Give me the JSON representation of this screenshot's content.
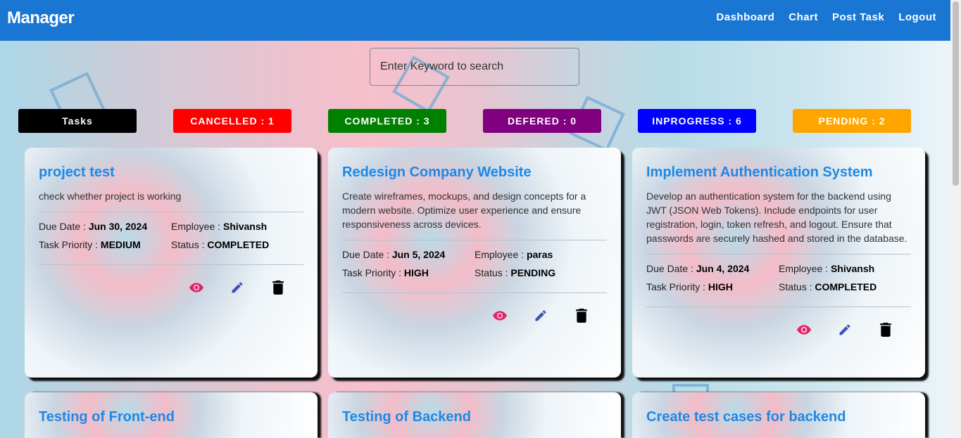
{
  "navbar": {
    "brand": "Manager",
    "links": [
      "Dashboard",
      "Chart",
      "Post Task",
      "Logout"
    ]
  },
  "search": {
    "placeholder": "Enter Keyword to search"
  },
  "badges": [
    {
      "label": "Tasks",
      "color": "#000000"
    },
    {
      "label": "CANCELLED : 1",
      "color": "#ff0000"
    },
    {
      "label": "COMPLETED : 3",
      "color": "#008000"
    },
    {
      "label": "DEFERED : 0",
      "color": "#800080"
    },
    {
      "label": "INPROGRESS : 6",
      "color": "#0000ff"
    },
    {
      "label": "PENDING : 2",
      "color": "#ffa500"
    }
  ],
  "labels": {
    "due_date": "Due Date :",
    "employee": "Employee :",
    "priority": "Task Priority :",
    "status": "Status :"
  },
  "cards": [
    {
      "title": "project test",
      "description": "check whether project is working",
      "due_date": "Jun 30, 2024",
      "employee": "Shivansh",
      "priority": "MEDIUM",
      "status": "COMPLETED"
    },
    {
      "title": "Redesign Company Website",
      "description": "Create wireframes, mockups, and design concepts for a modern website. Optimize user experience and ensure responsiveness across devices.",
      "due_date": "Jun 5, 2024",
      "employee": "paras",
      "priority": "HIGH",
      "status": "PENDING"
    },
    {
      "title": "Implement Authentication System",
      "description": "Develop an authentication system for the backend using JWT (JSON Web Tokens). Include endpoints for user registration, login, token refresh, and logout. Ensure that passwords are securely hashed and stored in the database.",
      "due_date": "Jun 4, 2024",
      "employee": "Shivansh",
      "priority": "HIGH",
      "status": "COMPLETED"
    },
    {
      "title": "Testing of Front-end"
    },
    {
      "title": "Testing of Backend"
    },
    {
      "title": "Create test cases for backend"
    }
  ],
  "icons": {
    "view": "eye-icon",
    "edit": "pencil-icon",
    "delete": "trash-icon"
  },
  "colors": {
    "navbar": "#1976d2",
    "card_title": "#1e88e5",
    "view_icon": "#e91e63",
    "edit_icon": "#3f51b5",
    "delete_icon": "#000000"
  }
}
